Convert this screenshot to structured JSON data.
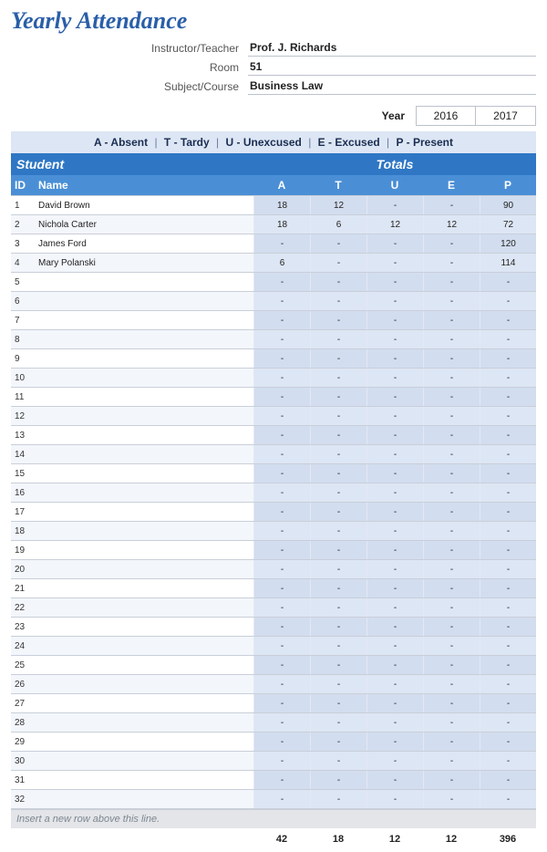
{
  "title": "Yearly Attendance",
  "meta": {
    "instructor_label": "Instructor/Teacher",
    "instructor_value": "Prof. J. Richards",
    "room_label": "Room",
    "room_value": "51",
    "subject_label": "Subject/Course",
    "subject_value": "Business Law"
  },
  "year": {
    "label": "Year",
    "options": [
      "2016",
      "2017"
    ]
  },
  "legend": {
    "items": [
      "A - Absent",
      "T - Tardy",
      "U - Unexcused",
      "E - Excused",
      "P - Present"
    ]
  },
  "sections": {
    "student": "Student",
    "totals": "Totals"
  },
  "columns": {
    "id": "ID",
    "name": "Name",
    "totals": [
      "A",
      "T",
      "U",
      "E",
      "P"
    ]
  },
  "students": [
    {
      "id": 1,
      "name": "David Brown",
      "A": "18",
      "T": "12",
      "U": "-",
      "E": "-",
      "P": "90"
    },
    {
      "id": 2,
      "name": "Nichola Carter",
      "A": "18",
      "T": "6",
      "U": "12",
      "E": "12",
      "P": "72"
    },
    {
      "id": 3,
      "name": "James Ford",
      "A": "-",
      "T": "-",
      "U": "-",
      "E": "-",
      "P": "120"
    },
    {
      "id": 4,
      "name": "Mary Polanski",
      "A": "6",
      "T": "-",
      "U": "-",
      "E": "-",
      "P": "114"
    },
    {
      "id": 5,
      "name": "",
      "A": "-",
      "T": "-",
      "U": "-",
      "E": "-",
      "P": "-"
    },
    {
      "id": 6,
      "name": "",
      "A": "-",
      "T": "-",
      "U": "-",
      "E": "-",
      "P": "-"
    },
    {
      "id": 7,
      "name": "",
      "A": "-",
      "T": "-",
      "U": "-",
      "E": "-",
      "P": "-"
    },
    {
      "id": 8,
      "name": "",
      "A": "-",
      "T": "-",
      "U": "-",
      "E": "-",
      "P": "-"
    },
    {
      "id": 9,
      "name": "",
      "A": "-",
      "T": "-",
      "U": "-",
      "E": "-",
      "P": "-"
    },
    {
      "id": 10,
      "name": "",
      "A": "-",
      "T": "-",
      "U": "-",
      "E": "-",
      "P": "-"
    },
    {
      "id": 11,
      "name": "",
      "A": "-",
      "T": "-",
      "U": "-",
      "E": "-",
      "P": "-"
    },
    {
      "id": 12,
      "name": "",
      "A": "-",
      "T": "-",
      "U": "-",
      "E": "-",
      "P": "-"
    },
    {
      "id": 13,
      "name": "",
      "A": "-",
      "T": "-",
      "U": "-",
      "E": "-",
      "P": "-"
    },
    {
      "id": 14,
      "name": "",
      "A": "-",
      "T": "-",
      "U": "-",
      "E": "-",
      "P": "-"
    },
    {
      "id": 15,
      "name": "",
      "A": "-",
      "T": "-",
      "U": "-",
      "E": "-",
      "P": "-"
    },
    {
      "id": 16,
      "name": "",
      "A": "-",
      "T": "-",
      "U": "-",
      "E": "-",
      "P": "-"
    },
    {
      "id": 17,
      "name": "",
      "A": "-",
      "T": "-",
      "U": "-",
      "E": "-",
      "P": "-"
    },
    {
      "id": 18,
      "name": "",
      "A": "-",
      "T": "-",
      "U": "-",
      "E": "-",
      "P": "-"
    },
    {
      "id": 19,
      "name": "",
      "A": "-",
      "T": "-",
      "U": "-",
      "E": "-",
      "P": "-"
    },
    {
      "id": 20,
      "name": "",
      "A": "-",
      "T": "-",
      "U": "-",
      "E": "-",
      "P": "-"
    },
    {
      "id": 21,
      "name": "",
      "A": "-",
      "T": "-",
      "U": "-",
      "E": "-",
      "P": "-"
    },
    {
      "id": 22,
      "name": "",
      "A": "-",
      "T": "-",
      "U": "-",
      "E": "-",
      "P": "-"
    },
    {
      "id": 23,
      "name": "",
      "A": "-",
      "T": "-",
      "U": "-",
      "E": "-",
      "P": "-"
    },
    {
      "id": 24,
      "name": "",
      "A": "-",
      "T": "-",
      "U": "-",
      "E": "-",
      "P": "-"
    },
    {
      "id": 25,
      "name": "",
      "A": "-",
      "T": "-",
      "U": "-",
      "E": "-",
      "P": "-"
    },
    {
      "id": 26,
      "name": "",
      "A": "-",
      "T": "-",
      "U": "-",
      "E": "-",
      "P": "-"
    },
    {
      "id": 27,
      "name": "",
      "A": "-",
      "T": "-",
      "U": "-",
      "E": "-",
      "P": "-"
    },
    {
      "id": 28,
      "name": "",
      "A": "-",
      "T": "-",
      "U": "-",
      "E": "-",
      "P": "-"
    },
    {
      "id": 29,
      "name": "",
      "A": "-",
      "T": "-",
      "U": "-",
      "E": "-",
      "P": "-"
    },
    {
      "id": 30,
      "name": "",
      "A": "-",
      "T": "-",
      "U": "-",
      "E": "-",
      "P": "-"
    },
    {
      "id": 31,
      "name": "",
      "A": "-",
      "T": "-",
      "U": "-",
      "E": "-",
      "P": "-"
    },
    {
      "id": 32,
      "name": "",
      "A": "-",
      "T": "-",
      "U": "-",
      "E": "-",
      "P": "-"
    }
  ],
  "insert_hint": "Insert a new row above this line.",
  "grand_totals": {
    "A": "42",
    "T": "18",
    "U": "12",
    "E": "12",
    "P": "396"
  },
  "colors": {
    "brand_blue": "#2f77c5",
    "brand_blue_light": "#4a8fd6",
    "pale_blue": "#dde6f4",
    "title_blue": "#2a5ea8"
  }
}
